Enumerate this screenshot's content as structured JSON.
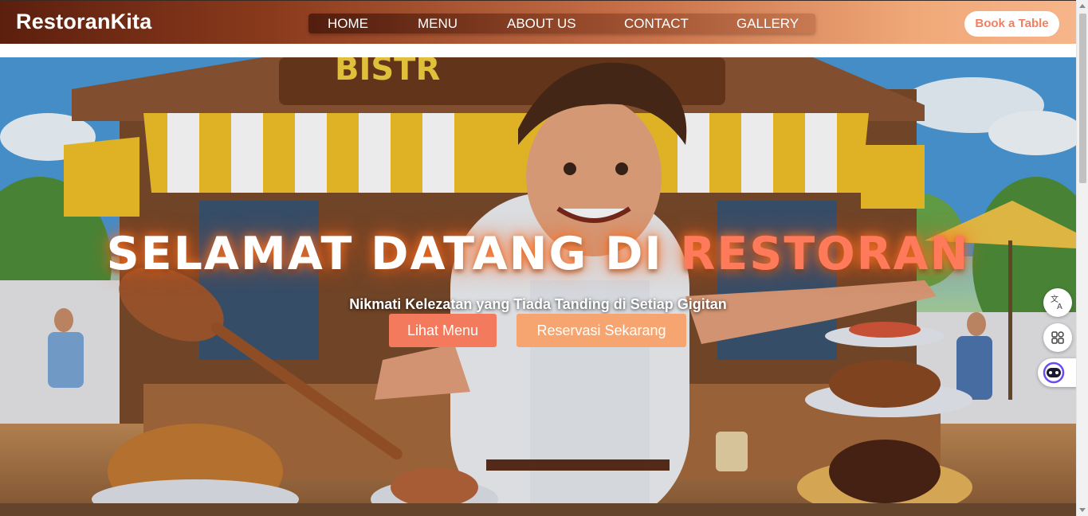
{
  "brand": {
    "name": "RestoranKita"
  },
  "nav": {
    "items": [
      {
        "label": "HOME"
      },
      {
        "label": "MENU"
      },
      {
        "label": "ABOUT US"
      },
      {
        "label": "CONTACT"
      },
      {
        "label": "GALLERY"
      }
    ]
  },
  "header": {
    "book_label": "Book a Table"
  },
  "hero": {
    "title_main": "SELAMAT DATANG DI ",
    "title_accent": "RESTORAN",
    "subtitle": "Nikmati Kelezatan yang Tiada Tanding di Setiap Gigitan",
    "btn_menu": "Lihat Menu",
    "btn_reserve": "Reservasi Sekarang",
    "image_sign_text": "BISTR"
  },
  "colors": {
    "accent": "#ff7a5a",
    "button_primary": "#f47a5e",
    "button_secondary": "#f6a570",
    "nav_dark": "#5c1f0e",
    "nav_light": "#f6b58a"
  },
  "icons": {
    "translate": "translate-icon",
    "apps": "apps-grid-icon",
    "assistant": "assistant-face-icon"
  }
}
